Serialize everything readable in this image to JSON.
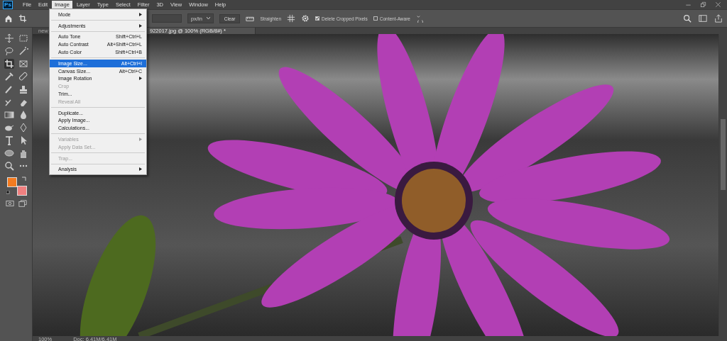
{
  "app_logo": "Ps",
  "menu_bar": [
    {
      "label": "File",
      "selected": false
    },
    {
      "label": "Edit",
      "selected": false
    },
    {
      "label": "Image",
      "selected": true
    },
    {
      "label": "Layer",
      "selected": false
    },
    {
      "label": "Type",
      "selected": false
    },
    {
      "label": "Select",
      "selected": false
    },
    {
      "label": "Filter",
      "selected": false
    },
    {
      "label": "3D",
      "selected": false
    },
    {
      "label": "View",
      "selected": false
    },
    {
      "label": "Window",
      "selected": false
    },
    {
      "label": "Help",
      "selected": false
    }
  ],
  "options_bar": {
    "unit": "px/in",
    "clear_button": "Clear",
    "straighten_button": "Straighten",
    "checkboxes": [
      {
        "label": "Delete Cropped Pixels",
        "checked": true
      },
      {
        "label": "Content-Aware",
        "checked": false
      }
    ]
  },
  "tabs": [
    {
      "label": "new",
      "selected": false
    },
    {
      "label": "922017.jpg @ 100% (RGB/8#) *",
      "selected": true
    }
  ],
  "tools": [
    {
      "selected": false
    },
    {
      "selected": false
    },
    {
      "selected": false
    },
    {
      "selected": false
    },
    {
      "selected": true
    },
    {
      "selected": false
    },
    {
      "selected": false
    },
    {
      "selected": false
    },
    {
      "selected": false
    },
    {
      "selected": false
    },
    {
      "selected": false
    },
    {
      "selected": false
    },
    {
      "selected": false
    },
    {
      "selected": false
    },
    {
      "selected": false
    },
    {
      "selected": false
    },
    {
      "selected": false
    },
    {
      "selected": false
    },
    {
      "selected": false
    },
    {
      "selected": false
    },
    {
      "selected": false
    },
    {
      "selected": false
    }
  ],
  "image_menu": [
    [
      {
        "label": "Mode",
        "submenu": true,
        "disabled": false,
        "selected": false
      }
    ],
    [
      {
        "label": "Adjustments",
        "submenu": true,
        "disabled": false,
        "selected": false
      }
    ],
    [
      {
        "label": "Auto Tone",
        "shortcut": "Shift+Ctrl+L",
        "submenu": false,
        "disabled": false,
        "selected": false
      },
      {
        "label": "Auto Contrast",
        "shortcut": "Alt+Shift+Ctrl+L",
        "submenu": false,
        "disabled": false,
        "selected": false
      },
      {
        "label": "Auto Color",
        "shortcut": "Shift+Ctrl+B",
        "submenu": false,
        "disabled": false,
        "selected": false
      }
    ],
    [
      {
        "label": "Image Size...",
        "shortcut": "Alt+Ctrl+I",
        "submenu": false,
        "disabled": false,
        "selected": true
      },
      {
        "label": "Canvas Size...",
        "shortcut": "Alt+Ctrl+C",
        "submenu": false,
        "disabled": false,
        "selected": false
      },
      {
        "label": "Image Rotation",
        "submenu": true,
        "disabled": false,
        "selected": false
      },
      {
        "label": "Crop",
        "submenu": false,
        "disabled": true,
        "selected": false
      },
      {
        "label": "Trim...",
        "submenu": false,
        "disabled": false,
        "selected": false
      },
      {
        "label": "Reveal All",
        "submenu": false,
        "disabled": true,
        "selected": false
      }
    ],
    [
      {
        "label": "Duplicate...",
        "submenu": false,
        "disabled": false,
        "selected": false
      },
      {
        "label": "Apply Image...",
        "submenu": false,
        "disabled": false,
        "selected": false
      },
      {
        "label": "Calculations...",
        "submenu": false,
        "disabled": false,
        "selected": false
      }
    ],
    [
      {
        "label": "Variables",
        "submenu": true,
        "disabled": true,
        "selected": false
      },
      {
        "label": "Apply Data Set...",
        "submenu": false,
        "disabled": true,
        "selected": false
      }
    ],
    [
      {
        "label": "Trap...",
        "submenu": false,
        "disabled": true,
        "selected": false
      }
    ],
    [
      {
        "label": "Analysis",
        "submenu": true,
        "disabled": false,
        "selected": false
      }
    ]
  ],
  "status_bar": {
    "zoom": "100%",
    "doc": "Doc: 6.41M/6.41M"
  }
}
